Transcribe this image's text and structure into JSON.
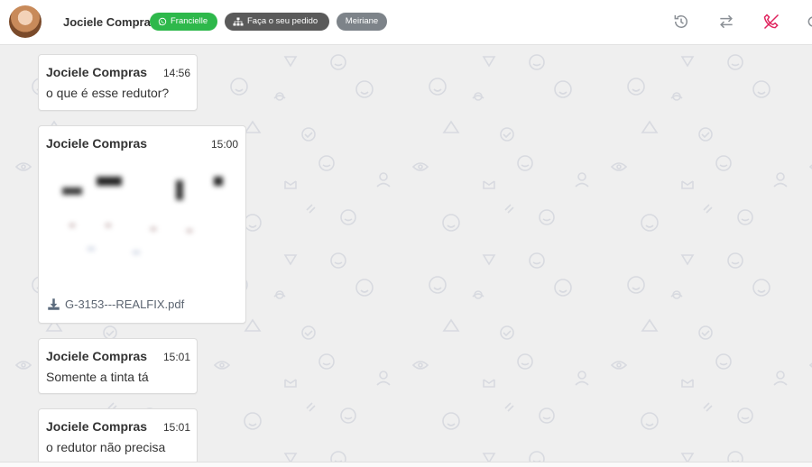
{
  "header": {
    "contact_name": "Jociele Compras",
    "tags": {
      "channel": "Francielle",
      "flow": "Faça o seu pedido",
      "agent": "Meiriane"
    },
    "icons": [
      "history-icon",
      "transfer-icon",
      "end-call-icon",
      "more-icon"
    ]
  },
  "colors": {
    "channel_tag": "#2eb84b",
    "flow_tag": "#5a5a5a",
    "agent_tag": "#7d8389",
    "end_call": "#e0245e"
  },
  "messages": [
    {
      "sender": "Jociele Compras",
      "time": "14:56",
      "text": "o que é esse redutor?"
    },
    {
      "sender": "Jociele Compras",
      "time": "15:00",
      "attachment": {
        "icon": "download-icon",
        "filename": "G-3153---REALFIX.pdf"
      }
    },
    {
      "sender": "Jociele Compras",
      "time": "15:01",
      "text": "Somente a tinta tá"
    },
    {
      "sender": "Jociele Compras",
      "time": "15:01",
      "text": "o redutor não precisa"
    }
  ]
}
